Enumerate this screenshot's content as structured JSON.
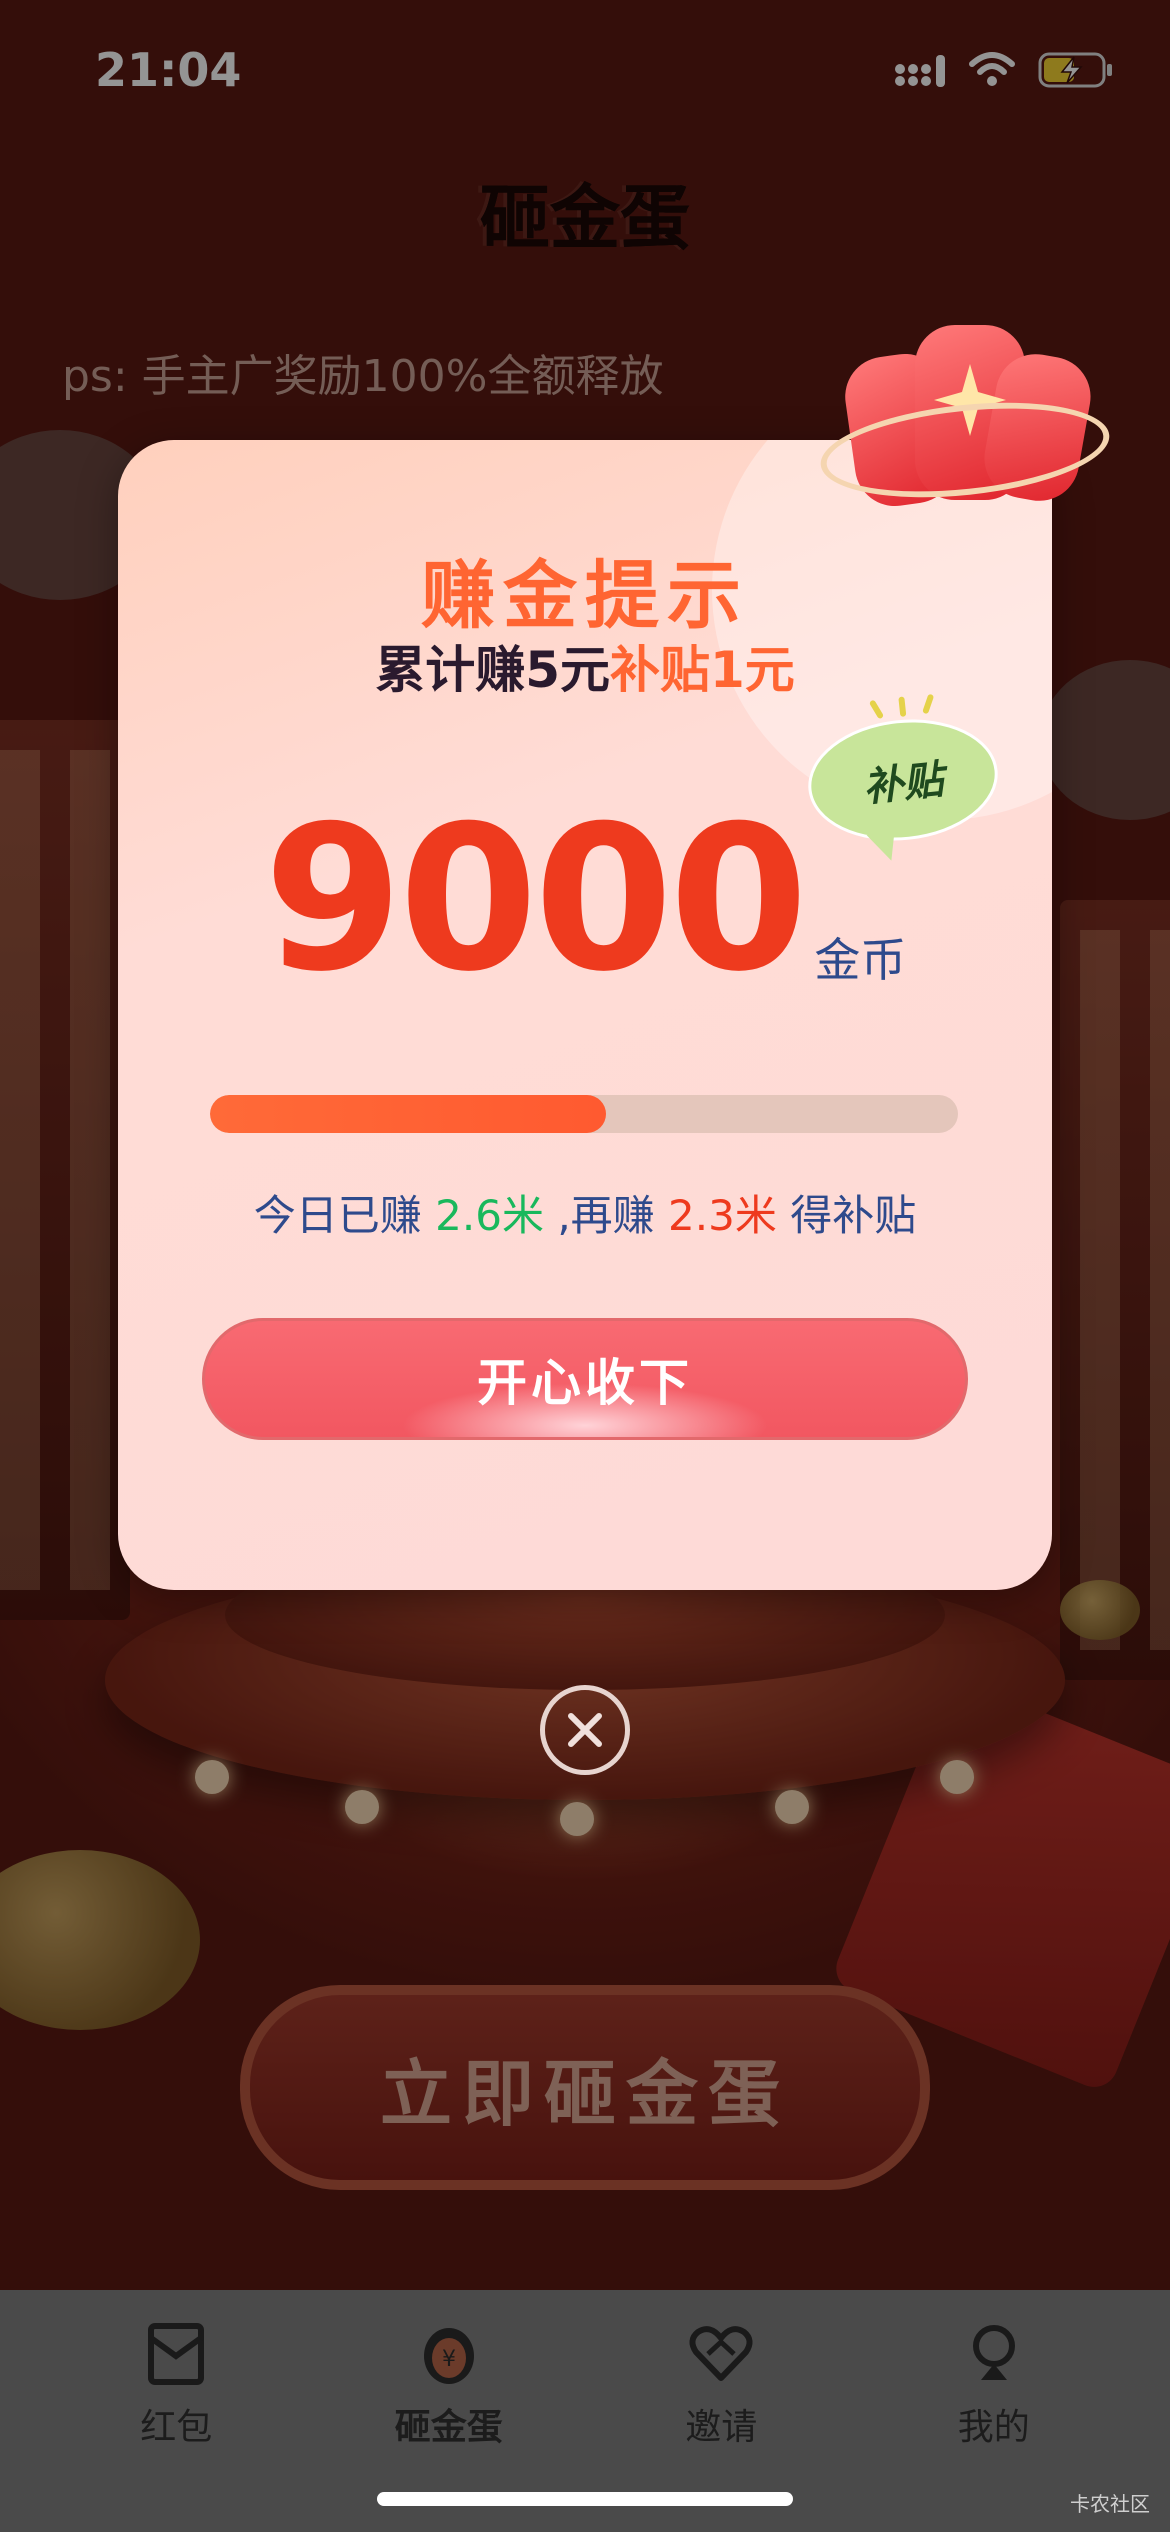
{
  "status_bar": {
    "time": "21:04"
  },
  "header": {
    "title": "砸金蛋"
  },
  "notice": "ps: 手主广奖励100%全额释放",
  "background": {
    "cta_label": "立即砸金蛋"
  },
  "modal": {
    "title": "赚金提示",
    "subtitle_prefix": "累计赚5元",
    "subtitle_highlight": "补贴1元",
    "badge": "补贴",
    "amount": "9000",
    "amount_unit": "金币",
    "progress": 0.53,
    "earn": {
      "prefix": "今日已赚",
      "earned": "2.6米",
      "middle": ",再赚",
      "remaining": "2.3米",
      "suffix": "得补贴"
    },
    "accept_label": "开心收下"
  },
  "tabs": [
    {
      "label": "红包",
      "icon": "red-envelope-icon"
    },
    {
      "label": "砸金蛋",
      "icon": "golden-egg-icon",
      "active": true
    },
    {
      "label": "邀请",
      "icon": "heart-handshake-icon"
    },
    {
      "label": "我的",
      "icon": "profile-icon"
    }
  ],
  "watermark": "卡农社区",
  "colors": {
    "accent": "#ff6532",
    "amount": "#ee3a1e",
    "green": "#19b85c",
    "button": "#f25761"
  }
}
